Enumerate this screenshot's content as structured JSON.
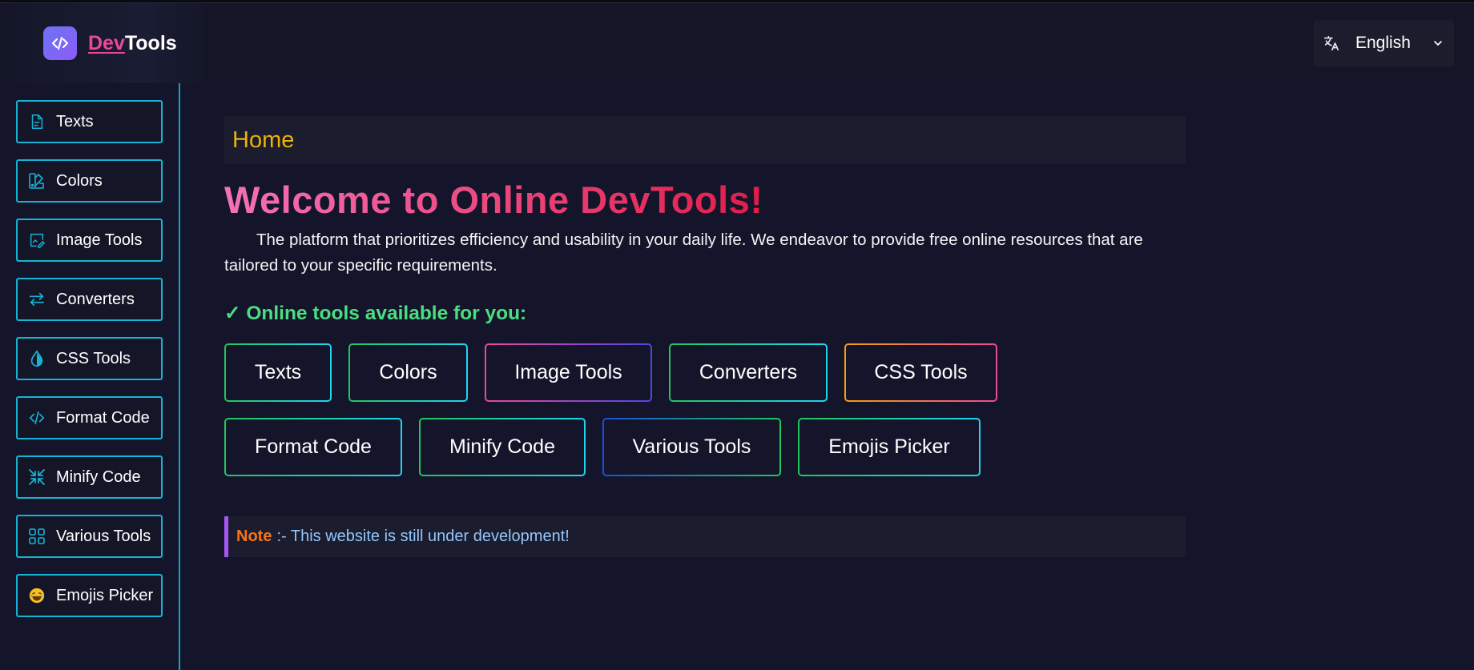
{
  "header": {
    "brand_dev": "Dev",
    "brand_tools": "Tools",
    "language": "English"
  },
  "sidebar": {
    "items": [
      {
        "label": "Texts",
        "icon": "file-text-icon"
      },
      {
        "label": "Colors",
        "icon": "palette-icon"
      },
      {
        "label": "Image Tools",
        "icon": "image-edit-icon"
      },
      {
        "label": "Converters",
        "icon": "arrows-swap-icon"
      },
      {
        "label": "CSS Tools",
        "icon": "drop-icon"
      },
      {
        "label": "Format Code",
        "icon": "code-icon"
      },
      {
        "label": "Minify Code",
        "icon": "minimize-icon"
      },
      {
        "label": "Various Tools",
        "icon": "grid-icon"
      },
      {
        "label": "Emojis Picker",
        "icon": "emoji-icon"
      }
    ]
  },
  "main": {
    "breadcrumb": "Home",
    "title": "Welcome to Online DevTools!",
    "intro": "The platform that prioritizes efficiency and usability in your daily life. We endeavor to provide free online resources that are tailored to your specific requirements.",
    "available_heading": "✓ Online tools available for you:",
    "tools_row1": [
      {
        "label": "Texts"
      },
      {
        "label": "Colors"
      },
      {
        "label": "Image Tools"
      },
      {
        "label": "Converters"
      },
      {
        "label": "CSS Tools"
      }
    ],
    "tools_row2": [
      {
        "label": "Format Code"
      },
      {
        "label": "Minify Code"
      },
      {
        "label": "Various Tools"
      },
      {
        "label": "Emojis Picker"
      }
    ],
    "note_title": "Note",
    "note_message": ":- This website is still under development!"
  },
  "colors": {
    "accent_cyan": "#15b4d4",
    "brand_pink": "#ec4899",
    "heading_green": "#4ade80",
    "breadcrumb_yellow": "#eab308",
    "note_orange": "#f97316",
    "note_blue": "#93c5fd"
  }
}
